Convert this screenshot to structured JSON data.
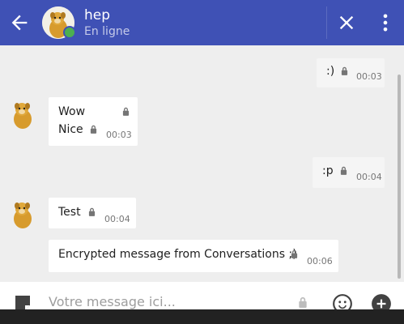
{
  "header": {
    "contact_name": "hep",
    "contact_status": "En ligne",
    "accent_color": "#3f51b5",
    "presence_color": "#4caf50",
    "icons": [
      "arrow-left-icon",
      "close-icon",
      "more-vert-icon"
    ]
  },
  "messages": [
    {
      "direction": "sent",
      "lines": [
        ":)"
      ],
      "time": "00:03"
    },
    {
      "direction": "received",
      "lines": [
        "Wow",
        "Nice"
      ],
      "time": "00:03"
    },
    {
      "direction": "sent",
      "lines": [
        ":p"
      ],
      "time": "00:04"
    },
    {
      "direction": "received",
      "lines": [
        "Test"
      ],
      "time": "00:04"
    },
    {
      "direction": "received",
      "lines": [
        "Encrypted message from Conversations ;)"
      ],
      "time": "00:06"
    }
  ],
  "compose": {
    "placeholder": "Votre message ici...",
    "icons": [
      "sticker-icon",
      "lock-icon",
      "emoji-icon",
      "add-icon"
    ]
  }
}
